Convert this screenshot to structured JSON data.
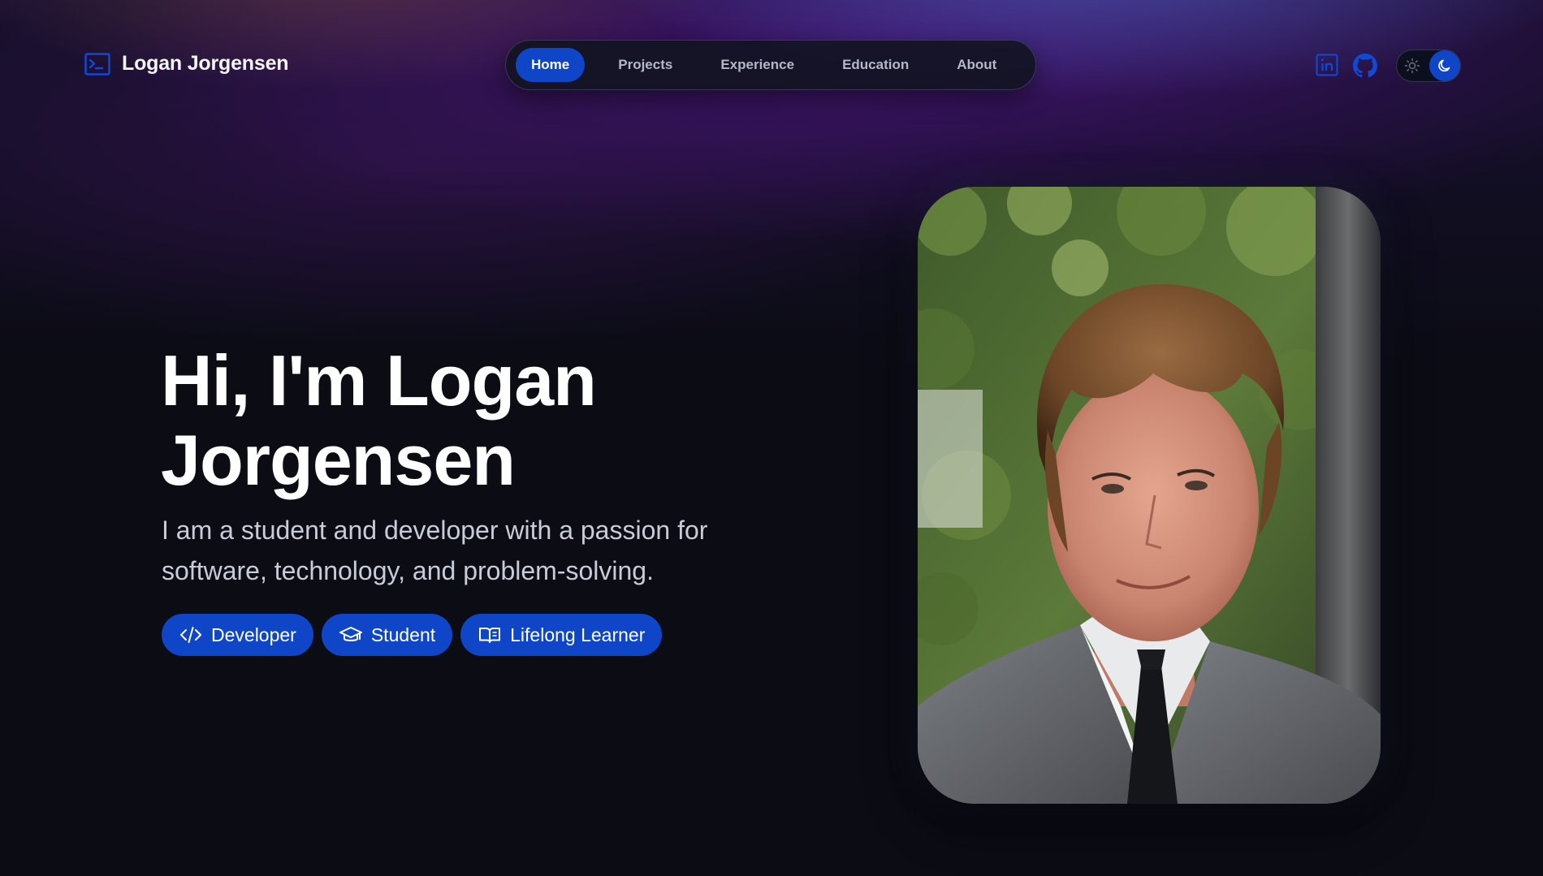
{
  "brand": {
    "name": "Logan Jorgensen",
    "icon": "terminal-icon"
  },
  "nav": {
    "items": [
      {
        "label": "Home",
        "active": true
      },
      {
        "label": "Projects",
        "active": false
      },
      {
        "label": "Experience",
        "active": false
      },
      {
        "label": "Education",
        "active": false
      },
      {
        "label": "About",
        "active": false
      }
    ]
  },
  "social": {
    "linkedin": "linkedin-icon",
    "github": "github-icon"
  },
  "theme_toggle": {
    "mode": "dark",
    "icons": [
      "sun-icon",
      "moon-icon"
    ]
  },
  "hero": {
    "title_line1": "Hi, I'm Logan",
    "title_line2": "Jorgensen",
    "subtitle": "I am a student and developer with a passion for software, technology, and problem-solving.",
    "badges": [
      {
        "label": "Developer",
        "icon": "code-icon"
      },
      {
        "label": "Student",
        "icon": "graduation-cap-icon"
      },
      {
        "label": "Lifelong Learner",
        "icon": "book-open-icon"
      }
    ]
  },
  "colors": {
    "accent": "#0f46c8",
    "background": "#0b0c14",
    "nav_text": "#b4b8c8",
    "subtitle_text": "#c8ccd8"
  }
}
